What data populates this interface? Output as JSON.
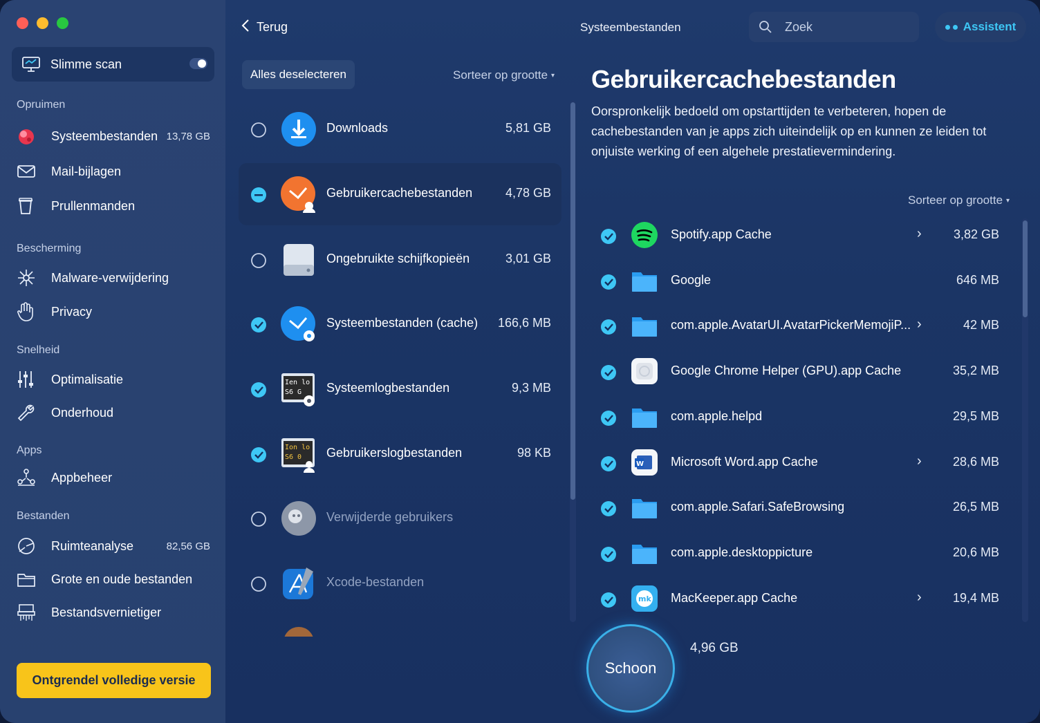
{
  "sidebar": {
    "smart_scan": "Slimme scan",
    "sections": {
      "cleanup": "Opruimen",
      "protection": "Bescherming",
      "speed": "Snelheid",
      "apps": "Apps",
      "files": "Bestanden"
    },
    "items": {
      "system_files": {
        "label": "Systeembestanden",
        "value": "13,78 GB"
      },
      "mail": {
        "label": "Mail-bijlagen"
      },
      "trash": {
        "label": "Prullenmanden"
      },
      "malware": {
        "label": "Malware-verwijdering"
      },
      "privacy": {
        "label": "Privacy"
      },
      "optimize": {
        "label": "Optimalisatie"
      },
      "maintenance": {
        "label": "Onderhoud"
      },
      "app_manager": {
        "label": "Appbeheer"
      },
      "space_lens": {
        "label": "Ruimteanalyse",
        "value": "82,56 GB"
      },
      "large_old": {
        "label": "Grote en oude bestanden"
      },
      "shredder": {
        "label": "Bestandsvernietiger"
      }
    },
    "unlock": "Ontgrendel volledige versie"
  },
  "topbar": {
    "back": "Terug",
    "title": "Systeembestanden",
    "search_placeholder": "Zoek",
    "assistant": "Assistent"
  },
  "middle": {
    "deselect": "Alles deselecteren",
    "sort": "Sorteer op grootte",
    "categories": [
      {
        "name": "Downloads",
        "size": "5,81 GB",
        "state": "unchecked"
      },
      {
        "name": "Gebruikercachebestanden",
        "size": "4,78 GB",
        "state": "partial"
      },
      {
        "name": "Ongebruikte schijfkopieën",
        "size": "3,01 GB",
        "state": "unchecked"
      },
      {
        "name": "Systeembestanden (cache)",
        "size": "166,6 MB",
        "state": "checked"
      },
      {
        "name": "Systeemlogbestanden",
        "size": "9,3 MB",
        "state": "checked"
      },
      {
        "name": "Gebruikerslogbestanden",
        "size": "98 KB",
        "state": "checked"
      },
      {
        "name": "Verwijderde gebruikers",
        "size": "",
        "state": "unchecked"
      },
      {
        "name": "Xcode-bestanden",
        "size": "",
        "state": "unchecked"
      }
    ]
  },
  "detail": {
    "title": "Gebruikercachebestanden",
    "description": "Oorspronkelijk bedoeld om opstarttijden te verbeteren, hopen de cachebestanden van je apps zich uiteindelijk op en kunnen ze leiden tot onjuiste werking of een algehele prestatievermindering.",
    "sort": "Sorteer op grootte",
    "items": [
      {
        "name": "Spotify.app Cache",
        "size": "3,82 GB",
        "icon": "spotify-icon",
        "chevron": true
      },
      {
        "name": "Google",
        "size": "646 MB",
        "icon": "folder-icon",
        "chevron": false
      },
      {
        "name": "com.apple.AvatarUI.AvatarPickerMemojiP...",
        "size": "42 MB",
        "icon": "folder-icon",
        "chevron": true
      },
      {
        "name": "Google Chrome Helper (GPU).app Cache",
        "size": "35,2 MB",
        "icon": "app-icon",
        "chevron": false
      },
      {
        "name": "com.apple.helpd",
        "size": "29,5 MB",
        "icon": "folder-icon",
        "chevron": false
      },
      {
        "name": "Microsoft Word.app Cache",
        "size": "28,6 MB",
        "icon": "word-icon",
        "chevron": true
      },
      {
        "name": "com.apple.Safari.SafeBrowsing",
        "size": "26,5 MB",
        "icon": "folder-icon",
        "chevron": false
      },
      {
        "name": "com.apple.desktoppicture",
        "size": "20,6 MB",
        "icon": "folder-icon",
        "chevron": false
      },
      {
        "name": "MacKeeper.app Cache",
        "size": "19,4 MB",
        "icon": "mackeeper-icon",
        "chevron": true
      }
    ]
  },
  "footer": {
    "clean_button": "Schoon",
    "total": "4,96 GB"
  },
  "colors": {
    "accent": "#3ec7f5",
    "unlock": "#f8c41a"
  }
}
